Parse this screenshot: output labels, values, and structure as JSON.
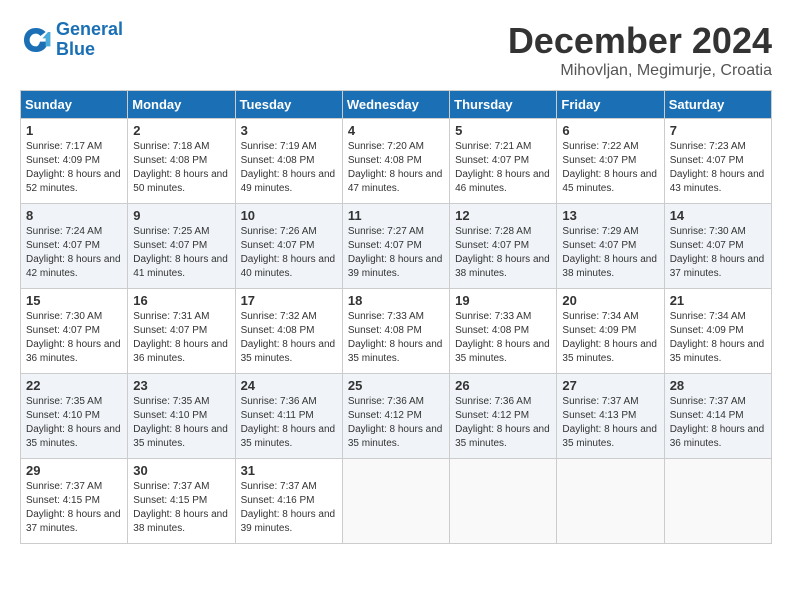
{
  "header": {
    "logo_line1": "General",
    "logo_line2": "Blue",
    "month": "December 2024",
    "location": "Mihovljan, Megimurje, Croatia"
  },
  "weekdays": [
    "Sunday",
    "Monday",
    "Tuesday",
    "Wednesday",
    "Thursday",
    "Friday",
    "Saturday"
  ],
  "weeks": [
    [
      {
        "day": "1",
        "sunrise": "7:17 AM",
        "sunset": "4:09 PM",
        "daylight": "8 hours and 52 minutes."
      },
      {
        "day": "2",
        "sunrise": "7:18 AM",
        "sunset": "4:08 PM",
        "daylight": "8 hours and 50 minutes."
      },
      {
        "day": "3",
        "sunrise": "7:19 AM",
        "sunset": "4:08 PM",
        "daylight": "8 hours and 49 minutes."
      },
      {
        "day": "4",
        "sunrise": "7:20 AM",
        "sunset": "4:08 PM",
        "daylight": "8 hours and 47 minutes."
      },
      {
        "day": "5",
        "sunrise": "7:21 AM",
        "sunset": "4:07 PM",
        "daylight": "8 hours and 46 minutes."
      },
      {
        "day": "6",
        "sunrise": "7:22 AM",
        "sunset": "4:07 PM",
        "daylight": "8 hours and 45 minutes."
      },
      {
        "day": "7",
        "sunrise": "7:23 AM",
        "sunset": "4:07 PM",
        "daylight": "8 hours and 43 minutes."
      }
    ],
    [
      {
        "day": "8",
        "sunrise": "7:24 AM",
        "sunset": "4:07 PM",
        "daylight": "8 hours and 42 minutes."
      },
      {
        "day": "9",
        "sunrise": "7:25 AM",
        "sunset": "4:07 PM",
        "daylight": "8 hours and 41 minutes."
      },
      {
        "day": "10",
        "sunrise": "7:26 AM",
        "sunset": "4:07 PM",
        "daylight": "8 hours and 40 minutes."
      },
      {
        "day": "11",
        "sunrise": "7:27 AM",
        "sunset": "4:07 PM",
        "daylight": "8 hours and 39 minutes."
      },
      {
        "day": "12",
        "sunrise": "7:28 AM",
        "sunset": "4:07 PM",
        "daylight": "8 hours and 38 minutes."
      },
      {
        "day": "13",
        "sunrise": "7:29 AM",
        "sunset": "4:07 PM",
        "daylight": "8 hours and 38 minutes."
      },
      {
        "day": "14",
        "sunrise": "7:30 AM",
        "sunset": "4:07 PM",
        "daylight": "8 hours and 37 minutes."
      }
    ],
    [
      {
        "day": "15",
        "sunrise": "7:30 AM",
        "sunset": "4:07 PM",
        "daylight": "8 hours and 36 minutes."
      },
      {
        "day": "16",
        "sunrise": "7:31 AM",
        "sunset": "4:07 PM",
        "daylight": "8 hours and 36 minutes."
      },
      {
        "day": "17",
        "sunrise": "7:32 AM",
        "sunset": "4:08 PM",
        "daylight": "8 hours and 35 minutes."
      },
      {
        "day": "18",
        "sunrise": "7:33 AM",
        "sunset": "4:08 PM",
        "daylight": "8 hours and 35 minutes."
      },
      {
        "day": "19",
        "sunrise": "7:33 AM",
        "sunset": "4:08 PM",
        "daylight": "8 hours and 35 minutes."
      },
      {
        "day": "20",
        "sunrise": "7:34 AM",
        "sunset": "4:09 PM",
        "daylight": "8 hours and 35 minutes."
      },
      {
        "day": "21",
        "sunrise": "7:34 AM",
        "sunset": "4:09 PM",
        "daylight": "8 hours and 35 minutes."
      }
    ],
    [
      {
        "day": "22",
        "sunrise": "7:35 AM",
        "sunset": "4:10 PM",
        "daylight": "8 hours and 35 minutes."
      },
      {
        "day": "23",
        "sunrise": "7:35 AM",
        "sunset": "4:10 PM",
        "daylight": "8 hours and 35 minutes."
      },
      {
        "day": "24",
        "sunrise": "7:36 AM",
        "sunset": "4:11 PM",
        "daylight": "8 hours and 35 minutes."
      },
      {
        "day": "25",
        "sunrise": "7:36 AM",
        "sunset": "4:12 PM",
        "daylight": "8 hours and 35 minutes."
      },
      {
        "day": "26",
        "sunrise": "7:36 AM",
        "sunset": "4:12 PM",
        "daylight": "8 hours and 35 minutes."
      },
      {
        "day": "27",
        "sunrise": "7:37 AM",
        "sunset": "4:13 PM",
        "daylight": "8 hours and 35 minutes."
      },
      {
        "day": "28",
        "sunrise": "7:37 AM",
        "sunset": "4:14 PM",
        "daylight": "8 hours and 36 minutes."
      }
    ],
    [
      {
        "day": "29",
        "sunrise": "7:37 AM",
        "sunset": "4:15 PM",
        "daylight": "8 hours and 37 minutes."
      },
      {
        "day": "30",
        "sunrise": "7:37 AM",
        "sunset": "4:15 PM",
        "daylight": "8 hours and 38 minutes."
      },
      {
        "day": "31",
        "sunrise": "7:37 AM",
        "sunset": "4:16 PM",
        "daylight": "8 hours and 39 minutes."
      },
      null,
      null,
      null,
      null
    ]
  ]
}
